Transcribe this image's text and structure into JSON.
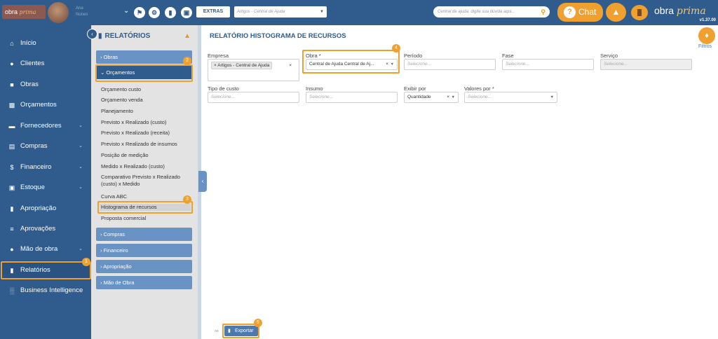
{
  "topbar": {
    "logo_text": "obra",
    "logo_accent": "prima",
    "user_name_line1": "Ana",
    "user_name_line2": "Nunes",
    "extras_label": "EXTRAS",
    "help_select_placeholder": "Artigos - Central de Ajuda",
    "help_search_placeholder": "Central de ajuda: digite sua dúvida aqui...",
    "chat_label": "Chat",
    "brand_name": "obra",
    "brand_accent": "prima",
    "version": "v1.37.00"
  },
  "sidebar": {
    "items": [
      {
        "label": "Início",
        "icon": "home-icon"
      },
      {
        "label": "Clientes",
        "icon": "user-icon"
      },
      {
        "label": "Obras",
        "icon": "buildings-icon"
      },
      {
        "label": "Orçamentos",
        "icon": "dollar-doc-icon"
      },
      {
        "label": "Fornecedores",
        "icon": "truck-icon"
      },
      {
        "label": "Compras",
        "icon": "cart-icon"
      },
      {
        "label": "Financeiro",
        "icon": "dollar-icon"
      },
      {
        "label": "Estoque",
        "icon": "box-icon"
      },
      {
        "label": "Apropriação",
        "icon": "file-icon"
      },
      {
        "label": "Aprovações",
        "icon": "checklist-icon"
      },
      {
        "label": "Mão de obra",
        "icon": "workers-icon"
      },
      {
        "label": "Relatórios",
        "icon": "report-icon"
      },
      {
        "label": "Business Intelligence",
        "icon": "bar-chart-icon"
      }
    ]
  },
  "subpanel": {
    "title": "RELATÓRIOS",
    "categories": {
      "obras": "Obras",
      "orcamentos": "Orçamentos",
      "compras": "Compras",
      "financeiro": "Financeiro",
      "apropriacao": "Apropriação",
      "mao_de_obra": "Mão de Obra"
    },
    "items": [
      "Orçamento custo",
      "Orçamento venda",
      "Planejamento",
      "Previsto x Realizado (custo)",
      "Previsto x Realizado (receita)",
      "Previsto x Realizado de insumos",
      "Posição de medição",
      "Medido x Realizado (custo)",
      "Comparativo Previsto x Realizado",
      "(custo) x Medido",
      "Curva ABC",
      "Histograma de recursos",
      "Proposta comercial"
    ]
  },
  "main": {
    "title": "RELATÓRIO HISTOGRAMA DE RECURSOS",
    "filtros_label": "Filtros",
    "fields": {
      "empresa_label": "Empresa",
      "empresa_value": "Artigos - Central de Ajuda",
      "obra_label": "Obra *",
      "obra_value": "Central de Ajuda Central de Aj...",
      "periodo_label": "Período",
      "periodo_placeholder": "Selecione...",
      "fase_label": "Fase",
      "fase_placeholder": "Selecione...",
      "servico_label": "Serviço",
      "servico_placeholder": "Selecione...",
      "tipo_custo_label": "Tipo de custo",
      "tipo_custo_placeholder": "Selecione...",
      "insumo_label": "Insumo",
      "insumo_placeholder": "Selecione...",
      "exibir_por_label": "Exibir por",
      "exibir_por_value": "Quantidade",
      "valores_por_label": "Valores por *",
      "valores_por_placeholder": "Selecione..."
    },
    "export_label": "Exportar"
  },
  "annotations": {
    "badges": [
      "1",
      "2",
      "3",
      "4",
      "5"
    ],
    "highlight_color": "#f0a02f"
  },
  "colors": {
    "primary": "#2f5c8d",
    "accent": "#f0a02f",
    "category": "#6893c4"
  }
}
